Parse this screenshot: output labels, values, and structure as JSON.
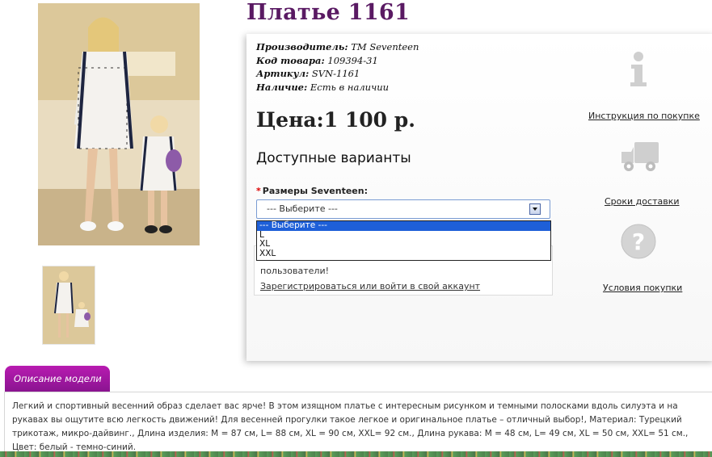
{
  "product": {
    "title": "Платье 1161",
    "info": [
      {
        "label": "Производитель:",
        "value": " TM Seventeen"
      },
      {
        "label": "Код товара:",
        "value": " 109394-31"
      },
      {
        "label": "Артикул:",
        "value": " SVN-1161"
      },
      {
        "label": "Наличие:",
        "value": " Есть в наличии"
      }
    ],
    "price": "Цена:1 100 р.",
    "variants_title": "Доступные варианты"
  },
  "size_selector": {
    "required_mark": "*",
    "label": "Размеры Seventeen:",
    "selected": "--- Выберите ---",
    "options": [
      "--- Выберите ---",
      "L",
      "XL",
      "XXL"
    ]
  },
  "notice": {
    "text": "пользователи!",
    "link": "Зарегистрироваться или войти в свой аккаунт"
  },
  "side_links": [
    {
      "label": "Инструкция по покупке",
      "icon": "info-icon"
    },
    {
      "label": "Сроки доставки",
      "icon": "truck-icon"
    },
    {
      "label": "Условия покупки",
      "icon": "question-icon"
    }
  ],
  "description": {
    "tab_label": "Описание модели",
    "text": "Легкий и спортивный весенний образ сделает вас ярче! В этом изящном платье с интересным рисунком и темными полосками вдоль силуэта и на рукавах вы ощутите всю легкость движений! Для весенней прогулки такое легкое и оригинальное платье – отличный выбор!, Материал: Турецкий трикотаж, микро-дайвинг., Длина изделия: M = 87 см, L= 88 см, XL = 90 см, XXL= 92 см., Длина рукава: M = 48 см, L= 49 см, XL = 50 см, XXL= 51 см., Цвет: белый - темно-синий."
  },
  "colors": {
    "title": "#5a1a63",
    "tab": "#a2179e",
    "dropdown_selected": "#1e5fd8"
  }
}
